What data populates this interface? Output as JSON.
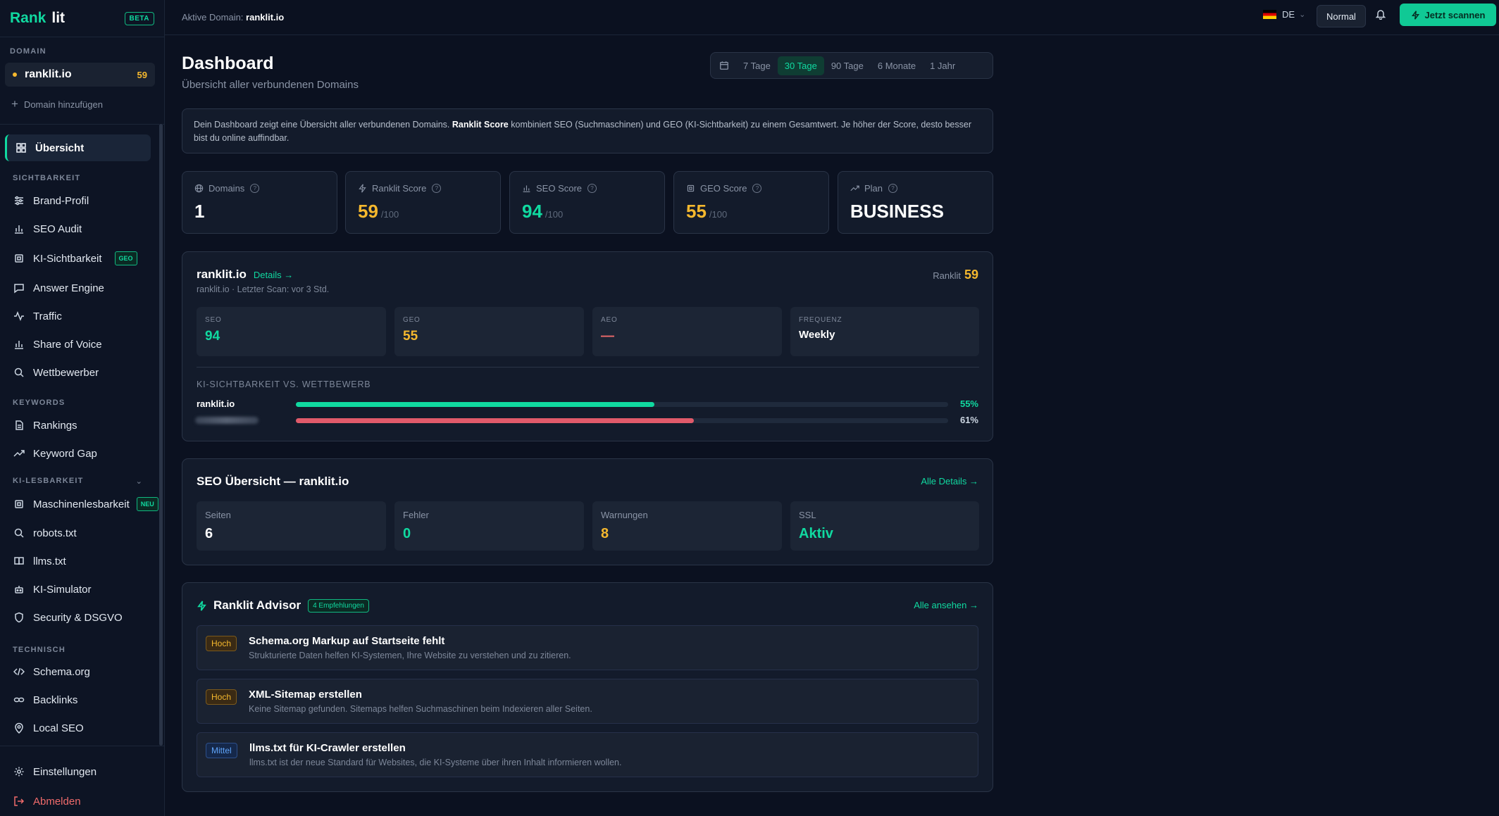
{
  "brand": {
    "part1": "Rank",
    "part2": "lit",
    "badge": "BETA"
  },
  "sidebar": {
    "domain_section": "DOMAIN",
    "domain": {
      "name": "ranklit.io",
      "score": "59"
    },
    "add_domain": "Domain hinzufügen",
    "items": {
      "overview": "Übersicht",
      "sec_visibility": "SICHTBARKEIT",
      "brand_profile": "Brand-Profil",
      "seo_audit": "SEO Audit",
      "ki_visibility": "KI-Sichtbarkeit",
      "ki_visibility_badge": "GEO",
      "answer_engine": "Answer Engine",
      "traffic": "Traffic",
      "share_of_voice": "Share of Voice",
      "competitors": "Wettbewerber",
      "sec_keywords": "KEYWORDS",
      "rankings": "Rankings",
      "keyword_gap": "Keyword Gap",
      "sec_readability": "KI-LESBARKEIT",
      "machine_readability": "Maschinenlesbarkeit",
      "machine_readability_badge": "NEU",
      "robots": "robots.txt",
      "llms": "llms.txt",
      "ki_simulator": "KI-Simulator",
      "security": "Security & DSGVO",
      "sec_technical": "TECHNISCH",
      "schema": "Schema.org",
      "backlinks": "Backlinks",
      "local_seo": "Local SEO"
    },
    "settings": "Einstellungen",
    "logout": "Abmelden"
  },
  "topbar": {
    "active_domain_label": "Aktive Domain:",
    "active_domain": "ranklit.io",
    "lang": "DE",
    "mode": "Normal",
    "scan": "Jetzt scannen"
  },
  "header": {
    "title": "Dashboard",
    "subtitle": "Übersicht aller verbundenen Domains"
  },
  "range": {
    "options": [
      "7 Tage",
      "30 Tage",
      "90 Tage",
      "6 Monate",
      "1 Jahr"
    ],
    "selected": "30 Tage"
  },
  "info": {
    "pre": "Dein Dashboard zeigt eine Übersicht aller verbundenen Domains. ",
    "bold": "Ranklit Score",
    "post": " kombiniert SEO (Suchmaschinen) und GEO (KI-Sichtbarkeit) zu einem Gesamtwert. Je höher der Score, desto besser bist du online auffindbar."
  },
  "stats": [
    {
      "label": "Domains",
      "value": "1",
      "suffix": ""
    },
    {
      "label": "Ranklit Score",
      "value": "59",
      "suffix": "/100"
    },
    {
      "label": "SEO Score",
      "value": "94",
      "suffix": "/100"
    },
    {
      "label": "GEO Score",
      "value": "55",
      "suffix": "/100"
    },
    {
      "label": "Plan",
      "value": "BUSINESS",
      "suffix": ""
    }
  ],
  "domain_card": {
    "name": "ranklit.io",
    "details": "Details →",
    "meta": "ranklit.io · Letzter Scan: vor 3 Std.",
    "score_label": "Ranklit",
    "score": "59",
    "metrics": [
      {
        "label": "SEO",
        "value": "94"
      },
      {
        "label": "GEO",
        "value": "55"
      },
      {
        "label": "AEO",
        "value": "—"
      },
      {
        "label": "FREQUENZ",
        "value": "Weekly"
      }
    ],
    "compare_title": "KI-SICHTBARKEIT VS. WETTBEWERB",
    "bars": [
      {
        "name": "ranklit.io",
        "percent": 55,
        "label": "55%",
        "color": "#10d9a0"
      },
      {
        "name": "",
        "percent": 61,
        "label": "61%",
        "color": "#e05a6a"
      }
    ]
  },
  "seo_card": {
    "title": "SEO Übersicht — ranklit.io",
    "link": "Alle Details →",
    "metrics": [
      {
        "label": "Seiten",
        "value": "6"
      },
      {
        "label": "Fehler",
        "value": "0"
      },
      {
        "label": "Warnungen",
        "value": "8"
      },
      {
        "label": "SSL",
        "value": "Aktiv"
      }
    ]
  },
  "advisor": {
    "title": "Ranklit Advisor",
    "badge": "4 Empfehlungen",
    "link": "Alle ansehen →",
    "items": [
      {
        "tag": "Hoch",
        "title": "Schema.org Markup auf Startseite fehlt",
        "desc": "Strukturierte Daten helfen KI-Systemen, Ihre Website zu verstehen und zu zitieren."
      },
      {
        "tag": "Hoch",
        "title": "XML-Sitemap erstellen",
        "desc": "Keine Sitemap gefunden. Sitemaps helfen Suchmaschinen beim Indexieren aller Seiten."
      },
      {
        "tag": "Mittel",
        "title": "llms.txt für KI-Crawler erstellen",
        "desc": "llms.txt ist der neue Standard für Websites, die KI-Systeme über ihren Inhalt informieren wollen."
      }
    ]
  },
  "colors": {
    "accent": "#10d9a0",
    "warning": "#f5b82e",
    "danger": "#e05a6a",
    "bg": "#0b1120"
  }
}
